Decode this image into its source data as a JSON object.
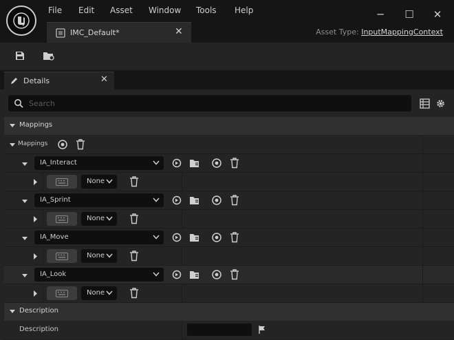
{
  "menu": [
    "File",
    "Edit",
    "Asset",
    "Window",
    "Tools",
    "Help"
  ],
  "window_controls": {
    "minimize": "─",
    "maximize": "☐",
    "close": "✕"
  },
  "asset_tab": {
    "label": "IMC_Default*",
    "close": "✕"
  },
  "asset_type": {
    "label": "Asset Type:",
    "value": "InputMappingContext"
  },
  "details_tab": {
    "label": "Details",
    "close": "✕"
  },
  "search": {
    "placeholder": "Search"
  },
  "sections": {
    "mappings_header": "Mappings",
    "mappings_array_label": "Mappings",
    "description_header": "Description"
  },
  "mappings": [
    {
      "action": "IA_Interact",
      "modifier": "None"
    },
    {
      "action": "IA_Sprint",
      "modifier": "None"
    },
    {
      "action": "IA_Move",
      "modifier": "None"
    },
    {
      "action": "IA_Look",
      "modifier": "None"
    }
  ],
  "description": {
    "label": "Description",
    "value": ""
  },
  "icons": [
    "unreal-logo-icon",
    "save-icon",
    "browse-to-asset-icon",
    "pencil-icon",
    "search-icon",
    "table-view-icon",
    "settings-gear-icon",
    "chevron-down-icon",
    "chevron-right-icon",
    "add-circle-icon",
    "trash-icon",
    "reset-icon",
    "folder-icon",
    "keyboard-icon",
    "flag-icon"
  ],
  "colors": {
    "background": "#151515",
    "panel": "#242424",
    "category": "#303030",
    "field": "#0f0f0f",
    "text": "#c0c0c0"
  }
}
